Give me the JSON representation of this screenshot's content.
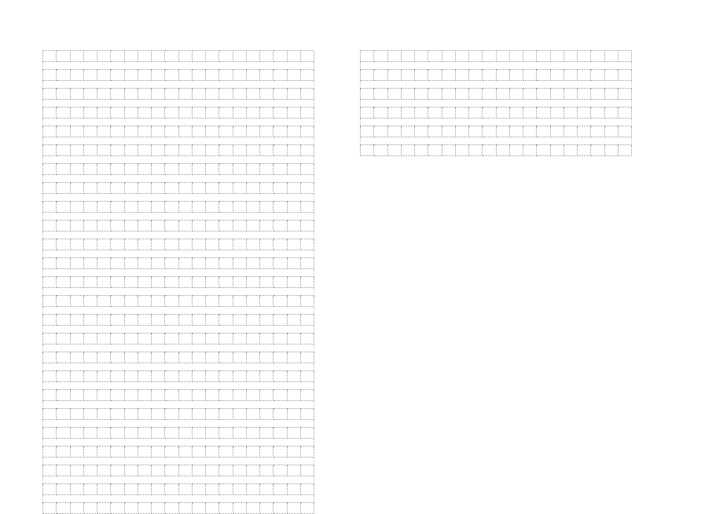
{
  "pages": [
    {
      "id": "page-1",
      "columns": 20,
      "rowPairs": 25,
      "trailingGap": false
    },
    {
      "id": "page-2",
      "columns": 20,
      "rowPairs": 6,
      "trailingGap": false
    }
  ],
  "colors": {
    "cellBorder": "#9a9a9a",
    "gapBorder": "#c0c0c0",
    "background": "#ffffff"
  }
}
